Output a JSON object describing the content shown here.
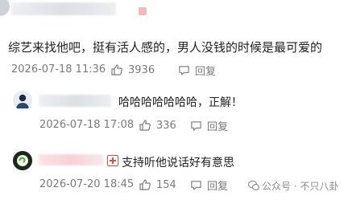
{
  "comments": [
    {
      "text": "综艺来找他吧，挺有活人感的，男人没钱的时候是最可爱的",
      "date": "2026-07-18 11:36",
      "likes": "3936",
      "reply_label": "回复"
    },
    {
      "text": "哈哈哈哈哈哈哈，正解！",
      "date": "2026-07-18 17:08",
      "likes": "336",
      "reply_label": "回复"
    },
    {
      "text": "支持听他说话好有意思",
      "date": "2026-07-20 18:45",
      "likes": "154",
      "reply_label": "回复"
    }
  ],
  "watermark": {
    "text": "公众号 · 不只八卦"
  },
  "colors": {
    "meta": "#7a7a7a",
    "badge_red": "#e54a4a"
  }
}
